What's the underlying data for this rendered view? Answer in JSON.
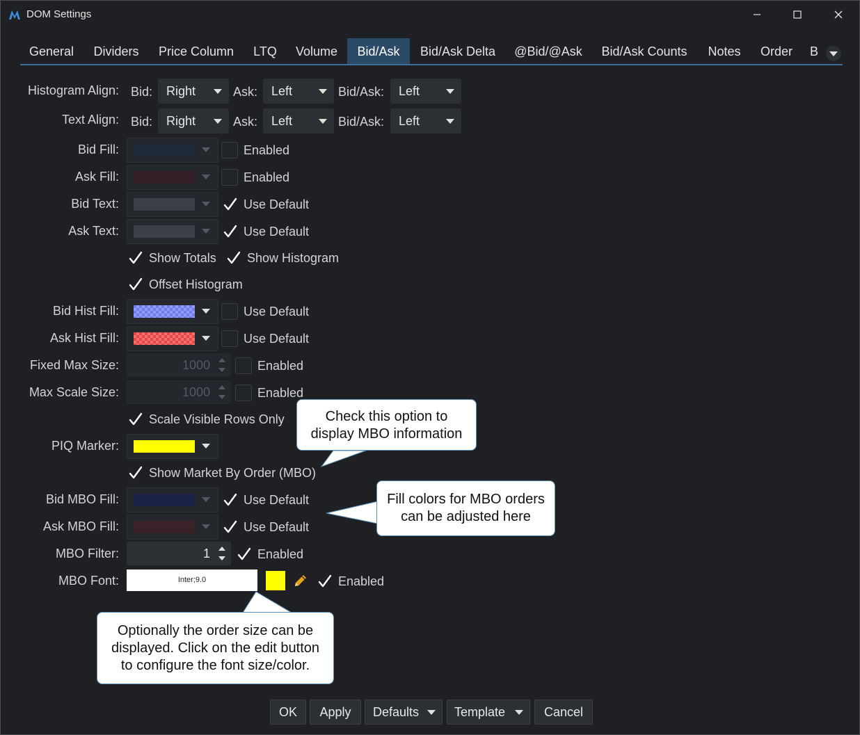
{
  "window": {
    "title": "DOM Settings"
  },
  "tabs": [
    "General",
    "Dividers",
    "Price Column",
    "LTQ",
    "Volume",
    "Bid/Ask",
    "Bid/Ask Delta",
    "@Bid/@Ask",
    "Bid/Ask Counts",
    "Notes",
    "Order",
    "B"
  ],
  "active_tab": "Bid/Ask",
  "histogram_align": {
    "label": "Histogram Align:",
    "bid_label": "Bid:",
    "bid": "Right",
    "ask_label": "Ask:",
    "ask": "Left",
    "bidask_label": "Bid/Ask:",
    "bidask": "Left"
  },
  "text_align": {
    "label": "Text Align:",
    "bid_label": "Bid:",
    "bid": "Right",
    "ask_label": "Ask:",
    "ask": "Left",
    "bidask_label": "Bid/Ask:",
    "bidask": "Left"
  },
  "bid_fill": {
    "label": "Bid Fill:",
    "check_label": "Enabled",
    "checked": false,
    "color": "#1c2a3a"
  },
  "ask_fill": {
    "label": "Ask Fill:",
    "check_label": "Enabled",
    "checked": false,
    "color": "#351f26"
  },
  "bid_text": {
    "label": "Bid Text:",
    "check_label": "Use Default",
    "checked": true,
    "color": "#3c3f45"
  },
  "ask_text": {
    "label": "Ask Text:",
    "check_label": "Use Default",
    "checked": true,
    "color": "#3c3f45"
  },
  "show_totals": {
    "label": "Show Totals",
    "checked": true
  },
  "show_histogram": {
    "label": "Show Histogram",
    "checked": true
  },
  "offset_histogram": {
    "label": "Offset Histogram",
    "checked": true
  },
  "bid_hist_fill": {
    "label": "Bid Hist Fill:",
    "check_label": "Use Default",
    "checked": false,
    "color": "#6f7bf0"
  },
  "ask_hist_fill": {
    "label": "Ask Hist Fill:",
    "check_label": "Use Default",
    "checked": false,
    "color": "#e84444"
  },
  "fixed_max_size": {
    "label": "Fixed Max Size:",
    "value": "1000",
    "check_label": "Enabled",
    "checked": false
  },
  "max_scale_size": {
    "label": "Max Scale Size:",
    "value": "1000",
    "check_label": "Enabled",
    "checked": false
  },
  "scale_visible_rows": {
    "label": "Scale Visible Rows Only",
    "checked": true
  },
  "piq_marker": {
    "label": "PIQ Marker:",
    "color": "#ffff00"
  },
  "show_mbo": {
    "label": "Show Market By Order (MBO)",
    "checked": true
  },
  "bid_mbo_fill": {
    "label": "Bid MBO Fill:",
    "check_label": "Use Default",
    "checked": true,
    "color": "#1c2248"
  },
  "ask_mbo_fill": {
    "label": "Ask MBO Fill:",
    "check_label": "Use Default",
    "checked": true,
    "color": "#3a2228"
  },
  "mbo_filter": {
    "label": "MBO Filter:",
    "value": "1",
    "check_label": "Enabled",
    "checked": true
  },
  "mbo_font": {
    "label": "MBO Font:",
    "value": "Inter;9.0",
    "color": "#ffff00",
    "check_label": "Enabled",
    "checked": true
  },
  "callouts": {
    "mbo": [
      "Check this option to",
      "display MBO information"
    ],
    "fill": [
      "Fill colors for MBO orders",
      "can be adjusted here"
    ],
    "font": [
      "Optionally the order size can be",
      "displayed. Click on the edit button",
      "to configure the font size/color."
    ]
  },
  "buttons": {
    "ok": "OK",
    "apply": "Apply",
    "defaults": "Defaults",
    "template": "Template",
    "cancel": "Cancel"
  }
}
